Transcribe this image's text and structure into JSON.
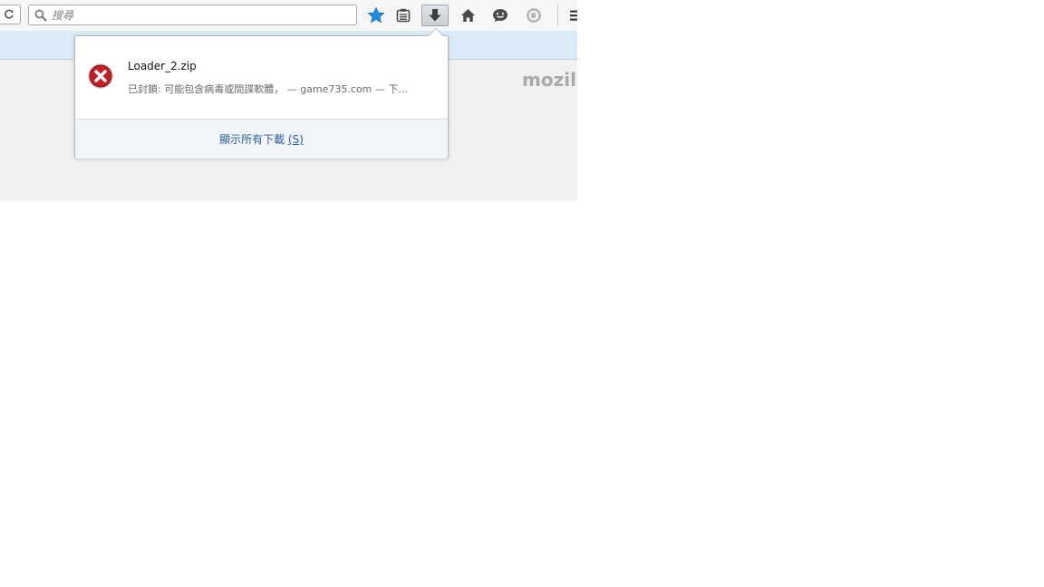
{
  "toolbar": {
    "search_placeholder": "搜尋",
    "buttons": [
      "reload",
      "bookmark-star",
      "reading-list",
      "downloads",
      "home",
      "hello-chat",
      "pocket",
      "menu"
    ]
  },
  "page": {
    "brand_text": "mozilla"
  },
  "downloads_panel": {
    "item": {
      "filename": "Loader_2.zip",
      "status": "已封鎖: 可能包含病毒或間諜軟體， — game735.com — 下..."
    },
    "footer": {
      "label": "顯示所有下載 ",
      "accesskey": "(S)"
    }
  },
  "colors": {
    "accent": "#1f8ee0",
    "blocked_icon": "#c21f26",
    "navbar": "#daebf8",
    "link": "#2d5f97"
  }
}
